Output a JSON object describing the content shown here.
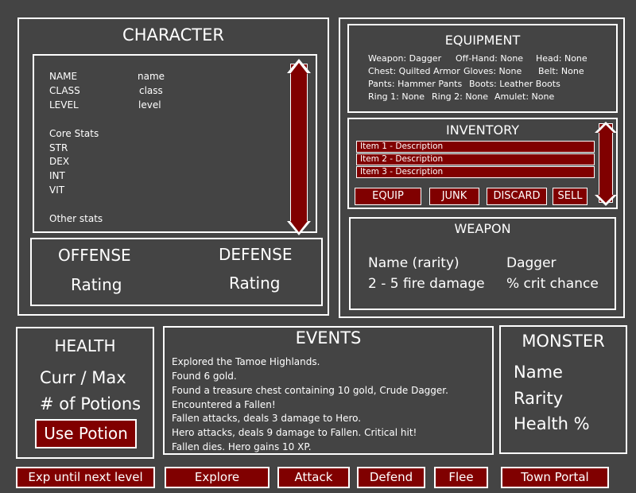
{
  "character": {
    "title": "CHARACTER",
    "name_label": "NAME",
    "name_value": "name",
    "class_label": "CLASS",
    "class_value": "class",
    "level_label": "LEVEL",
    "level_value": "level",
    "core_stats_label": "Core Stats",
    "str_label": "STR",
    "dex_label": "DEX",
    "int_label": "INT",
    "vit_label": "VIT",
    "other_stats_label": "Other stats",
    "offense_label": "OFFENSE",
    "offense_rating": "Rating",
    "defense_label": "DEFENSE",
    "defense_rating": "Rating"
  },
  "equipment": {
    "title": "EQUIPMENT",
    "weapon": "Weapon: Dagger",
    "offhand": "Off-Hand: None",
    "head": "Head: None",
    "chest": "Chest: Quilted Armor",
    "gloves": "Gloves: None",
    "belt": "Belt: None",
    "pants": "Pants: Hammer Pants",
    "boots": "Boots: Leather Boots",
    "ring1": "Ring 1: None",
    "ring2": "Ring 2: None",
    "amulet": "Amulet: None"
  },
  "inventory": {
    "title": "INVENTORY",
    "items": [
      "Item 1 - Description",
      "Item 2 - Description",
      "Item 3 - Description"
    ],
    "equip_label": "EQUIP",
    "junk_label": "JUNK",
    "discard_label": "DISCARD",
    "sell_label": "SELL"
  },
  "weapon": {
    "title": "WEAPON",
    "name_rarity": "Name (rarity)",
    "name": "Dagger",
    "damage": "2 - 5 fire damage",
    "crit": "% crit chance"
  },
  "health": {
    "title": "HEALTH",
    "curr_max": "Curr / Max",
    "potions": "# of Potions",
    "use_potion_label": "Use Potion"
  },
  "events": {
    "title": "EVENTS",
    "lines": [
      "Explored the Tamoe Highlands.",
      "Found 6 gold.",
      "Found a treasure chest containing 10 gold, Crude Dagger.",
      "Encountered a Fallen!",
      "Fallen attacks, deals 3 damage to Hero.",
      "Hero attacks, deals 9 damage to Fallen. Critical hit!",
      "Fallen dies. Hero gains 10 XP."
    ]
  },
  "monster": {
    "title": "MONSTER",
    "name": "Name",
    "rarity": "Rarity",
    "health": "Health %"
  },
  "actions": {
    "exp_label": "Exp until next level",
    "explore_label": "Explore",
    "attack_label": "Attack",
    "defend_label": "Defend",
    "flee_label": "Flee",
    "town_portal_label": "Town Portal"
  },
  "colors": {
    "background": "#444444",
    "accent": "#800000",
    "border": "#ffffff"
  }
}
